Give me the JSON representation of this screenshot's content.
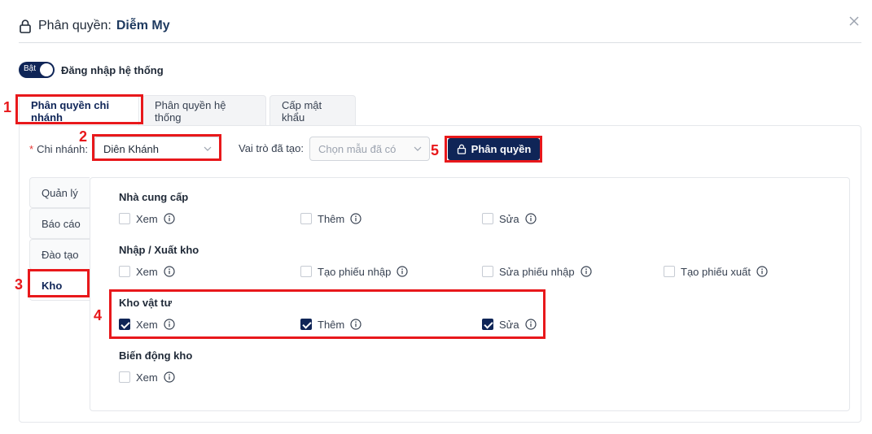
{
  "header": {
    "title_label": "Phân quyền:",
    "user_name": "Diễm My"
  },
  "toggle": {
    "state_text": "Bật",
    "label": "Đăng nhập hệ thống",
    "on": true
  },
  "tabs": [
    {
      "label": "Phân quyền chi nhánh",
      "active": true
    },
    {
      "label": "Phân quyền hệ thống",
      "active": false
    },
    {
      "label": "Cấp mật khẩu",
      "active": false
    }
  ],
  "filters": {
    "required_mark": "*",
    "branch_label": "Chi nhánh:",
    "branch_value": "Diên Khánh",
    "role_label": "Vai trò đã tạo:",
    "role_placeholder": "Chọn mẫu đã có",
    "permission_button": "Phân quyền"
  },
  "sidenav": [
    {
      "label": "Quản lý",
      "active": false
    },
    {
      "label": "Báo cáo",
      "active": false
    },
    {
      "label": "Đào tạo",
      "active": false
    },
    {
      "label": "Kho",
      "active": true
    }
  ],
  "groups": [
    {
      "title": "Nhà cung cấp",
      "items": [
        {
          "label": "Xem",
          "checked": false
        },
        {
          "label": "Thêm",
          "checked": false
        },
        {
          "label": "Sửa",
          "checked": false
        }
      ]
    },
    {
      "title": "Nhập / Xuất kho",
      "items": [
        {
          "label": "Xem",
          "checked": false
        },
        {
          "label": "Tạo phiếu nhập",
          "checked": false
        },
        {
          "label": "Sửa phiếu nhập",
          "checked": false
        },
        {
          "label": "Tạo phiếu xuất",
          "checked": false
        }
      ]
    },
    {
      "title": "Kho vật tư",
      "items": [
        {
          "label": "Xem",
          "checked": true
        },
        {
          "label": "Thêm",
          "checked": true
        },
        {
          "label": "Sửa",
          "checked": true
        }
      ]
    },
    {
      "title": "Biến động kho",
      "items": [
        {
          "label": "Xem",
          "checked": false
        }
      ]
    }
  ],
  "annotations": [
    "1",
    "2",
    "3",
    "4",
    "5"
  ],
  "colors": {
    "primary": "#0f2557",
    "annotation": "#e8181b"
  }
}
